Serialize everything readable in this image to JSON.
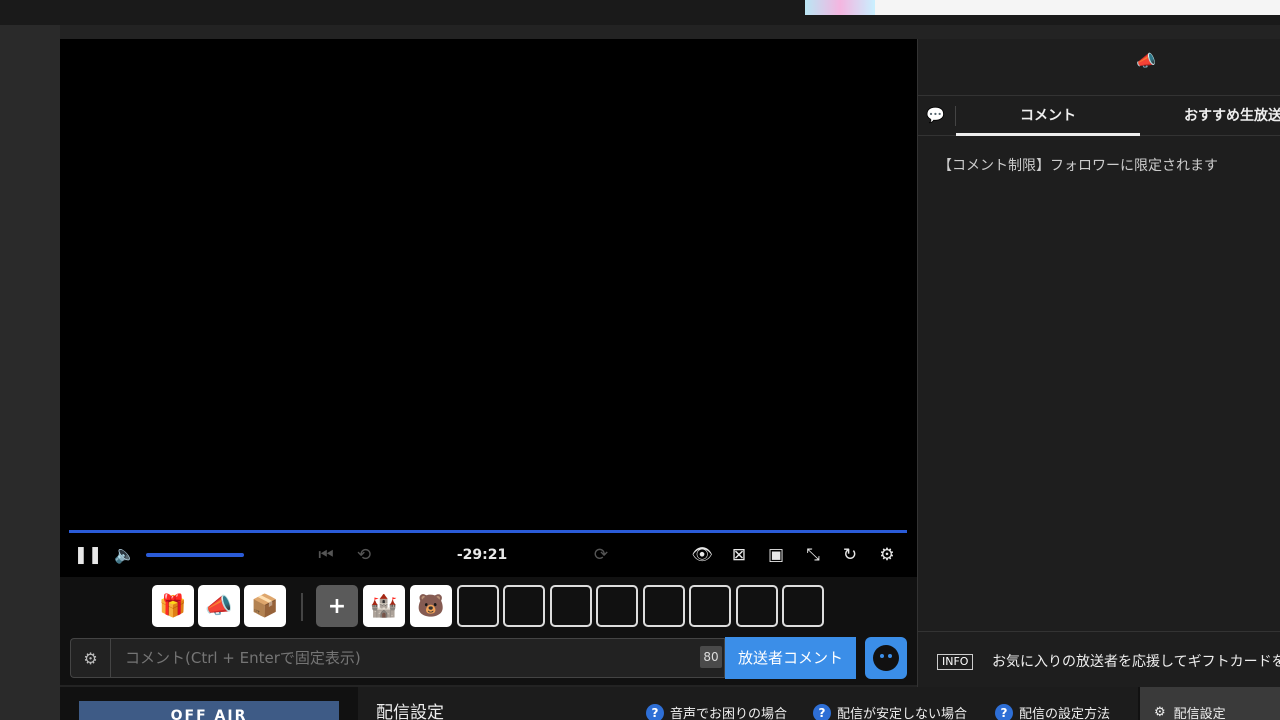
{
  "player": {
    "timecode": "-29:21",
    "progress_percent": 100,
    "volume_percent": 100,
    "controls": [
      "pause-icon",
      "volume-icon",
      "skip-back-icon",
      "rewind-10-icon",
      "forward-10-icon",
      "eye-icon",
      "close-box-icon",
      "theater-icon",
      "fullscreen-icon",
      "reload-icon",
      "gear-icon"
    ]
  },
  "giftbar": {
    "buttons": [
      "gift-icon",
      "announce-icon",
      "box-icon"
    ],
    "plus_label": "+",
    "items": [
      "castle-icon",
      "character-icon"
    ],
    "empty_slots": 8
  },
  "comment": {
    "placeholder": "コメント(Ctrl + Enterで固定表示)",
    "char_count": "80",
    "send_label": "放送者コメント"
  },
  "bottom": {
    "offair_label": "OFF AIR",
    "panel_title": "配信設定",
    "help_links": [
      "音声でお困りの場合",
      "配信が安定しない場合",
      "配信の設定方法"
    ],
    "settings_label": "配信設定"
  },
  "sidebar": {
    "tabs": [
      "コメント",
      "おすすめ生放送"
    ],
    "notice": "【コメント制限】フォロワーに限定されます",
    "info_badge": "INFO",
    "info_text": "お気に入りの放送者を応援してギフトカードを"
  },
  "colors": {
    "accent": "#3b8ee8",
    "seek": "#2a5bd7",
    "offair": "#3e5b86"
  }
}
